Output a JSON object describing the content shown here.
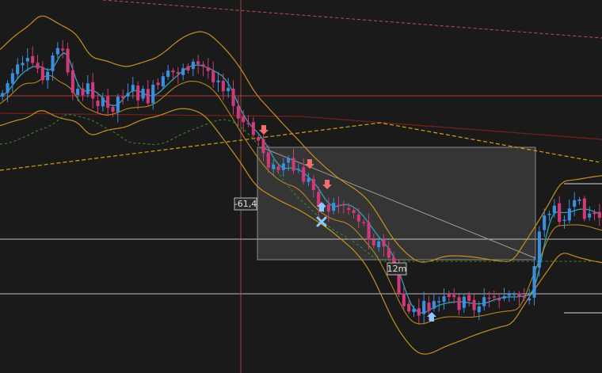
{
  "colors": {
    "background": "#1a1a1a",
    "bull": "#3a8fe0",
    "bear": "#d03a78",
    "bollinger": "#c8901e",
    "ma_fast": "#2aa5b5",
    "ma_slow_dashed": "#d4a017",
    "ma_green_dashed": "#3b8f2a",
    "red_level": "#b33636",
    "dark_red_line": "#7a1e1e",
    "crosshair": "#c0504d",
    "white_level": "#d9d9d9",
    "box_fill": "rgba(255,255,255,0.12)",
    "box_stroke": "#8a8a8a",
    "down_arrow": "#f07070",
    "up_arrow": "#8ec8ff",
    "cross_marker": "#8ec8ff"
  },
  "icons": {
    "sell_signal": "down-arrow-icon",
    "buy_signal": "up-arrow-icon",
    "exit_signal": "cross-icon"
  },
  "measure": {
    "price_change_label": "-61,4",
    "duration_label": "12m"
  },
  "chart_data": {
    "type": "candlestick",
    "title": "",
    "xlabel": "",
    "ylabel": "",
    "grid": false,
    "legend": "none",
    "candle_count": 120,
    "candles_note": "",
    "overlays": [
      "bollinger-upper",
      "bollinger-lower",
      "fast-moving-average",
      "slow-moving-average-dashed",
      "green-moving-average-dashed",
      "red-horizontal-level",
      "white-horizontal-levels",
      "dashed-red-trendline",
      "measurement-box",
      "trendline"
    ]
  }
}
